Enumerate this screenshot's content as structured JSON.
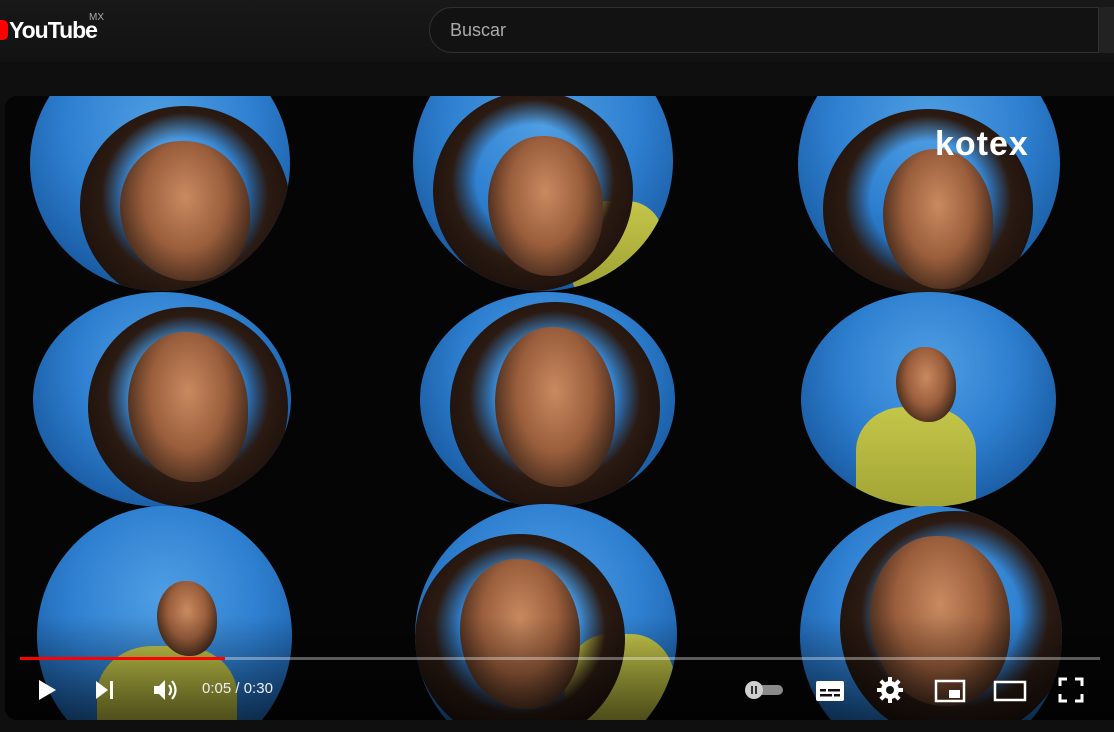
{
  "masthead": {
    "logo_text": "YouTube",
    "region": "MX",
    "search_placeholder": "Buscar"
  },
  "video": {
    "brand_watermark": "kotex",
    "current_time": "0:05",
    "duration": "0:30",
    "time_separator": " / ",
    "progress": 0.19
  },
  "controls": {
    "icons": [
      "play-icon",
      "next-icon",
      "volume-icon",
      "autoplay-toggle-icon",
      "subtitles-icon",
      "settings-icon",
      "miniplayer-icon",
      "theater-mode-icon",
      "fullscreen-icon"
    ]
  },
  "colors": {
    "accent": "#ff0000",
    "background": "#0f0f0f"
  }
}
